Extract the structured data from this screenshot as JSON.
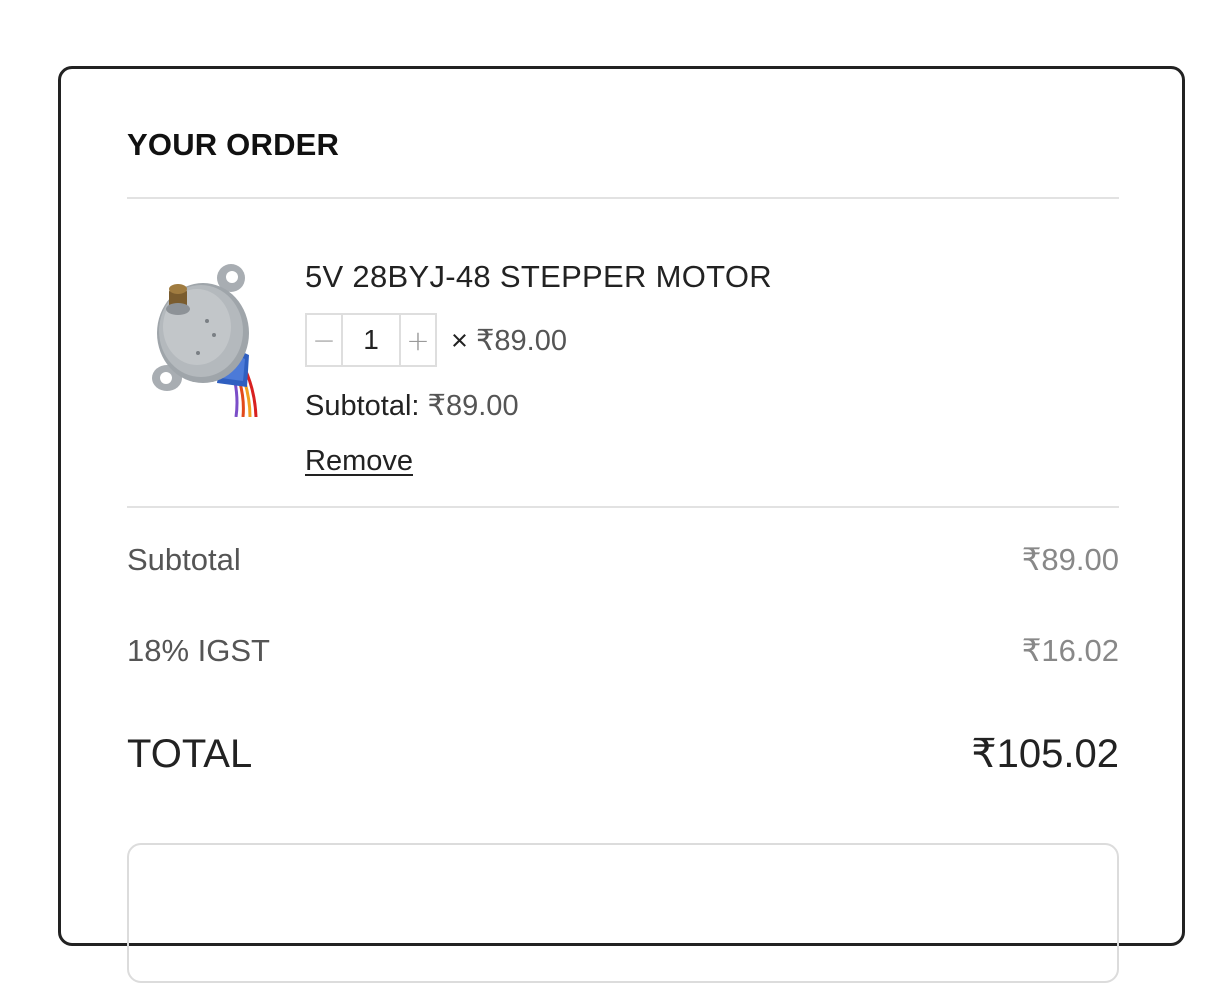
{
  "order": {
    "title": "YOUR ORDER",
    "item": {
      "name": "5V 28BYJ-48 STEPPER MOTOR",
      "image": "stepper-motor-image",
      "quantity": "1",
      "decrement_icon": "minus-icon",
      "increment_icon": "plus-icon",
      "decrement_symbol": "−",
      "increment_symbol": "+",
      "times_symbol": "×",
      "unit_price": "₹89.00",
      "subtotal_label": "Subtotal:",
      "subtotal_value": "₹89.00",
      "remove_label": "Remove"
    },
    "summary": {
      "subtotal_label": "Subtotal",
      "subtotal_value": "₹89.00",
      "tax_label": "18% IGST",
      "tax_value": "₹16.02",
      "total_label": "TOTAL",
      "total_value": "₹105.02"
    }
  },
  "colors": {
    "card_border": "#222222",
    "divider": "#e2e2e2",
    "muted_text": "#888888",
    "body_text": "#555555"
  }
}
